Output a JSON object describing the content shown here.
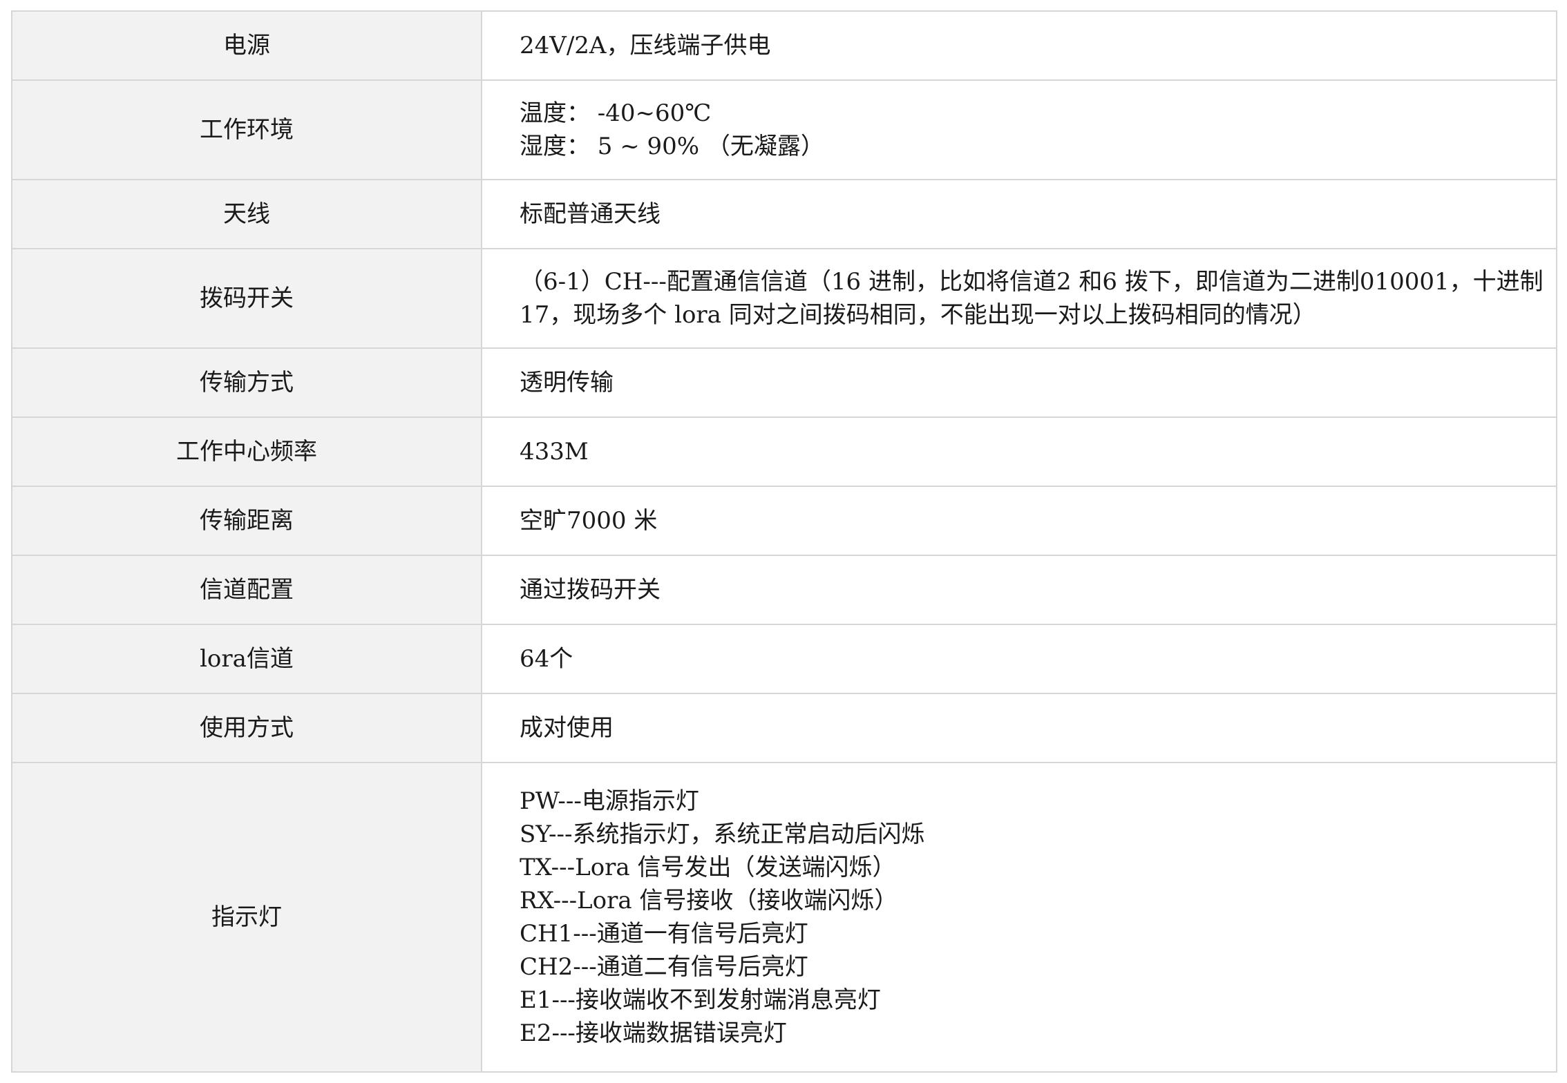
{
  "rows": [
    {
      "label": "电源",
      "lines": [
        "24V/2A，压线端子供电"
      ]
    },
    {
      "label": "工作环境",
      "lines": [
        "温度： -40~60℃",
        "湿度： 5 ~ 90% （无凝露）"
      ]
    },
    {
      "label": "天线",
      "lines": [
        "标配普通天线"
      ]
    },
    {
      "label": "拨码开关",
      "lines": [
        "（6-1）CH---配置通信信道（16 进制，比如将信道2 和6 拨下，即信道为二进制010001，十进制",
        "17，现场多个 lora 同对之间拨码相同，不能出现一对以上拨码相同的情况）"
      ]
    },
    {
      "label": "传输方式",
      "lines": [
        "透明传输"
      ]
    },
    {
      "label": "工作中心频率",
      "lines": [
        "433M"
      ]
    },
    {
      "label": "传输距离",
      "lines": [
        "空旷7000 米"
      ]
    },
    {
      "label": "信道配置",
      "lines": [
        "通过拨码开关"
      ]
    },
    {
      "label": "lora信道",
      "lines": [
        "64个"
      ]
    },
    {
      "label": "使用方式",
      "lines": [
        "成对使用"
      ]
    },
    {
      "label": "指示灯",
      "lines": [
        "PW---电源指示灯",
        "SY---系统指示灯，系统正常启动后闪烁",
        "TX---Lora 信号发出（发送端闪烁）",
        "RX---Lora 信号接收（接收端闪烁）",
        "CH1---通道一有信号后亮灯",
        "CH2---通道二有信号后亮灯",
        "E1---接收端收不到发射端消息亮灯",
        "E2---接收端数据错误亮灯"
      ]
    }
  ]
}
